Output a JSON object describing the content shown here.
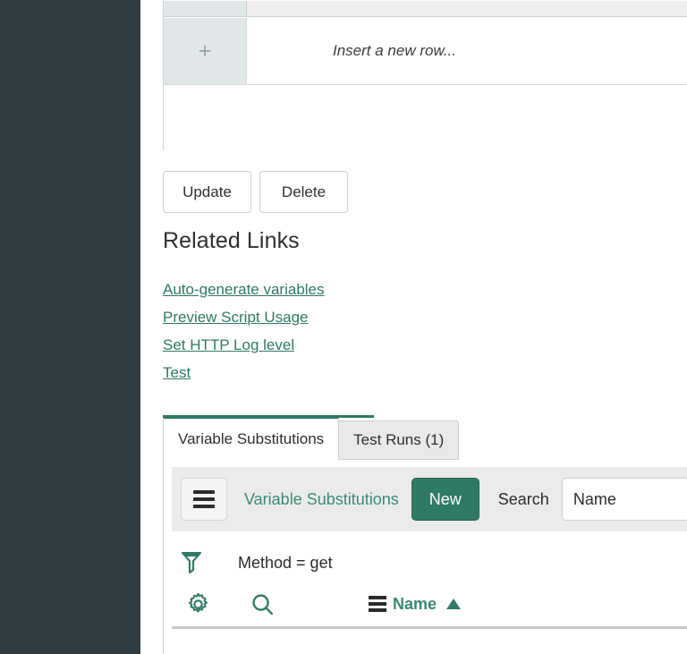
{
  "theme": {
    "sidebar_bg": "#2f3c42",
    "accent_green": "#2c7a66",
    "link_green": "#2c7a66",
    "toolbar_bg": "#ebebeb",
    "cell_grey": "#e2e7ea"
  },
  "record_table": {
    "insert_plus_icon": "plus-icon",
    "insert_row_label": "Insert a new row..."
  },
  "actions": {
    "update_label": "Update",
    "delete_label": "Delete"
  },
  "related_links": {
    "title": "Related Links",
    "items": [
      {
        "label": "Auto-generate variables"
      },
      {
        "label": "Preview Script Usage"
      },
      {
        "label": "Set HTTP Log level"
      },
      {
        "label": "Test"
      }
    ]
  },
  "tabs": [
    {
      "label": "Variable Substitutions",
      "active": true
    },
    {
      "label": "Test Runs (1)",
      "active": false
    }
  ],
  "list": {
    "menu_icon": "hamburger-icon",
    "title": "Variable Substitutions",
    "new_label": "New",
    "search_label": "Search",
    "search_field_value": "Name",
    "search_field_placeholder": "Search",
    "filter": {
      "icon": "funnel-icon",
      "text": "Method = get"
    },
    "columns": {
      "gear_icon": "gear-icon",
      "search_icon": "magnifier-icon",
      "name_menu_icon": "list-bars-icon",
      "name_label": "Name",
      "sort_icon": "sort-ascending-triangle-icon"
    }
  }
}
